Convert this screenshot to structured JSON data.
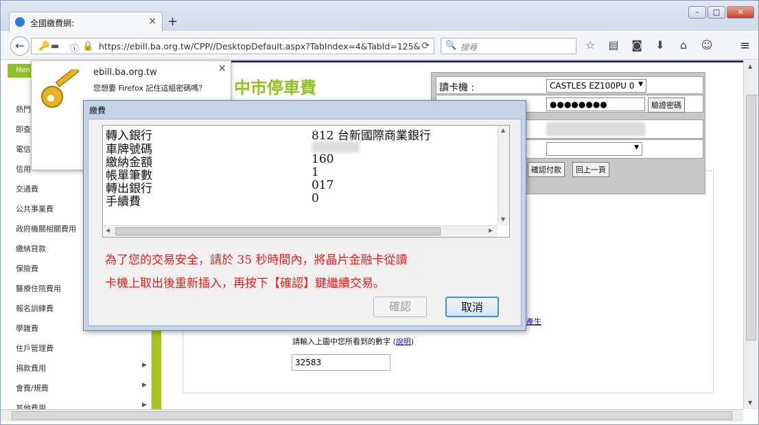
{
  "browser": {
    "tab_title": "全國繳費網:",
    "new_tab": "+",
    "url": "https://ebill.ba.org.tw/CPP//DesktopDefault.aspx?TabIndex=4&TabId=125&",
    "search_placeholder": "搜尋"
  },
  "doorhanger": {
    "site": "ebill.ba.org.tw",
    "question": "您想要 Firefox 記住這組密碼嗎？"
  },
  "sidebar": {
    "header": "Men",
    "items": [
      {
        "label": "熱門"
      },
      {
        "label": "即查"
      },
      {
        "label": "電信"
      },
      {
        "label": "信用"
      },
      {
        "label": "交通費"
      },
      {
        "label": "公共事業費"
      },
      {
        "label": "政府機關相關費用"
      },
      {
        "label": "繳納貸款"
      },
      {
        "label": "保險費"
      },
      {
        "label": "醫療住院費用"
      },
      {
        "label": "報名訓練費"
      },
      {
        "label": "學雜費"
      },
      {
        "label": "住戶管理費"
      },
      {
        "label": "捐款費用"
      },
      {
        "label": "會費/規費"
      },
      {
        "label": "其他費用"
      }
    ]
  },
  "page": {
    "title": "中市停車費",
    "card_reader_label": "讀卡機 :",
    "card_reader_value": "CASTLES EZ100PU 0",
    "pin_value": "●●●●●●●●",
    "verify_pin_button": "驗證密碼",
    "confirm_pay_button": "確認付款",
    "back_button": "回上一頁",
    "captcha_note": "請輸入上圖中您所看到的數字",
    "captcha_help": "說明",
    "captcha_value": "32583",
    "link_fragment": "產生"
  },
  "dialog": {
    "title": "繳費",
    "rows": [
      {
        "key": "轉入銀行",
        "value": "812  台新國際商業銀行"
      },
      {
        "key": "車牌號碼",
        "value": ""
      },
      {
        "key": "繳納金額",
        "value": "160"
      },
      {
        "key": "帳單筆數",
        "value": "1"
      },
      {
        "key": "轉出銀行",
        "value": "017"
      },
      {
        "key": "手續費",
        "value": "0"
      }
    ],
    "warning_line1": "為了您的交易安全，請於  35   秒時間內，將晶片金融卡從讀",
    "warning_line2": "卡機上取出後重新插入，再按下【確認】鍵繼續交易。",
    "confirm_button": "確認",
    "cancel_button": "取消"
  }
}
